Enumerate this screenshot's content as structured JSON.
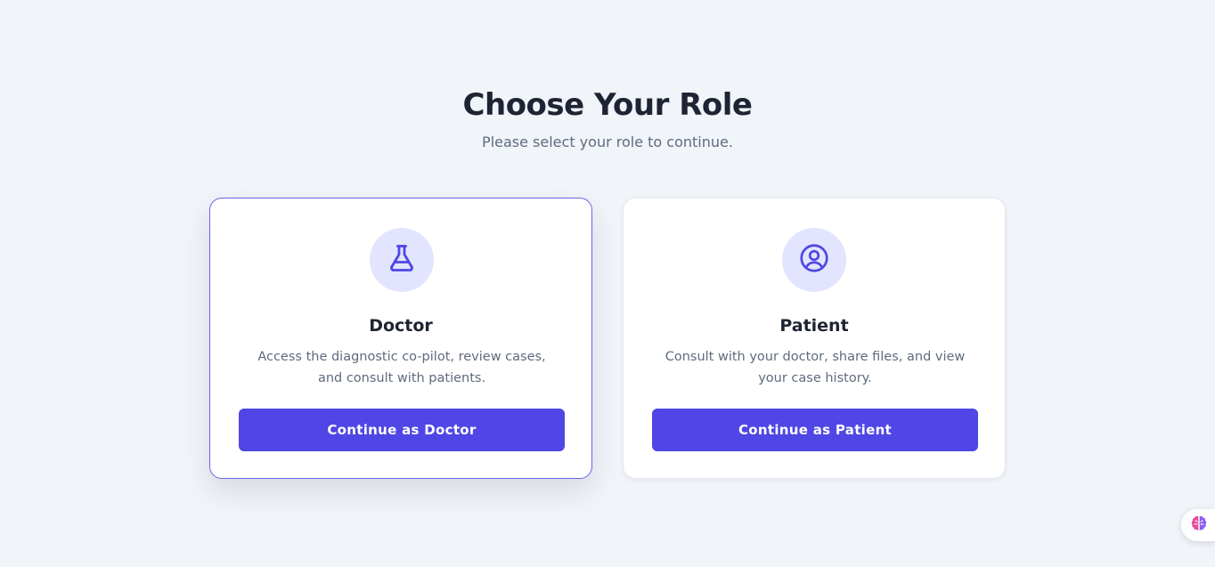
{
  "page": {
    "title": "Choose Your Role",
    "subtitle": "Please select your role to continue."
  },
  "roles": [
    {
      "title": "Doctor",
      "description": "Access the diagnostic co-pilot, review cases, and consult with patients.",
      "button_label": "Continue as Doctor",
      "icon": "flask-icon",
      "selected": true
    },
    {
      "title": "Patient",
      "description": "Consult with your doctor, share files, and view your case history.",
      "button_label": "Continue as Patient",
      "icon": "user-circle-icon",
      "selected": false
    }
  ],
  "floating_widget": {
    "icon": "brain-icon"
  },
  "colors": {
    "background": "#f1f4f9",
    "accent": "#4f46e5",
    "icon_bg": "#e2e5fd",
    "selected_border": "#6a64e8",
    "heading": "#1e2433",
    "muted_text": "#5f6b7e"
  }
}
